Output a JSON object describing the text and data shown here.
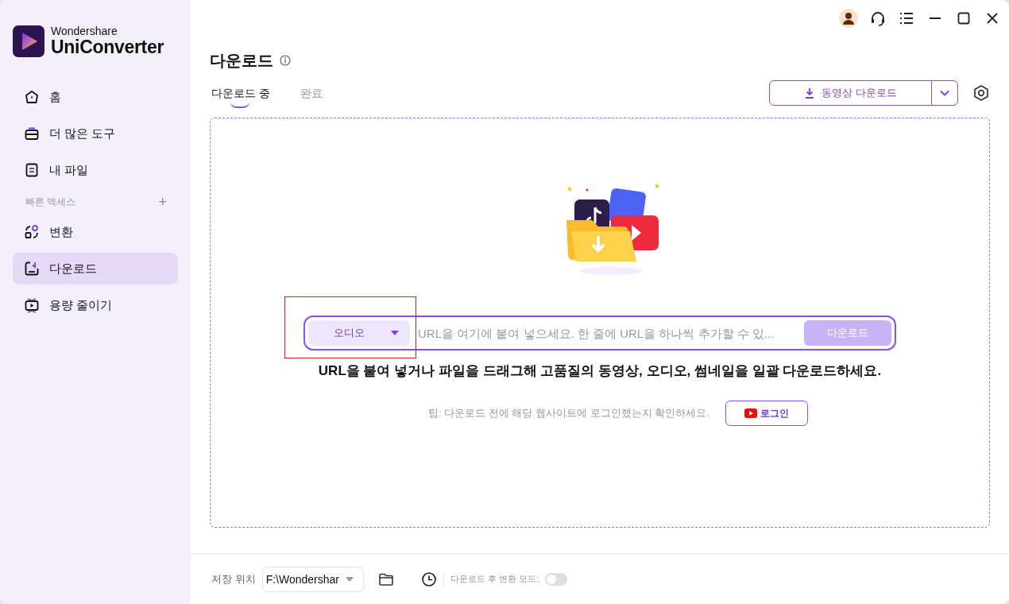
{
  "app": {
    "brand": "Wondershare",
    "product": "UniConverter"
  },
  "sidebar": {
    "items": [
      {
        "kind": "home",
        "label": "홈",
        "selected": false
      },
      {
        "kind": "tools",
        "label": "더 많은 도구",
        "selected": false
      },
      {
        "kind": "files",
        "label": "내 파일",
        "selected": false
      }
    ],
    "section": {
      "label": "빠른 액세스",
      "add": "+"
    },
    "quick_items": [
      {
        "kind": "convert",
        "label": "변환",
        "selected": false
      },
      {
        "kind": "download",
        "label": "다운로드",
        "selected": true
      },
      {
        "kind": "compress",
        "label": "용량 줄이기",
        "selected": false
      }
    ]
  },
  "page": {
    "title": "다운로드"
  },
  "tabs": [
    {
      "label": "다운로드 중",
      "selected": true
    },
    {
      "label": "완료",
      "selected": false
    }
  ],
  "video_download_button": "동영상 다운로드",
  "url_bar": {
    "format": "오디오",
    "format_highlighted": true,
    "placeholder": "URL을 여기에 붙여 넣으세요. 한 줄에 URL을 하나씩 추가할 수 있...",
    "button": "다운로드",
    "button_disabled": true
  },
  "hint": "URL을 붙여 넣거나 파일을 드래그해 고품질의 동영상, 오디오, 썸네일을 일괄 다운로드하세요.",
  "tip": "팁: 다운로드 전에 해당 웹사이트에 로그인했는지 확인하세요.",
  "login_button": "로그인",
  "footer": {
    "save_label": "저장 위치",
    "save_path": "F:\\Wondershar",
    "convert_mode_label": "다운로드 후 변환 모드:",
    "convert_mode_on": false
  }
}
